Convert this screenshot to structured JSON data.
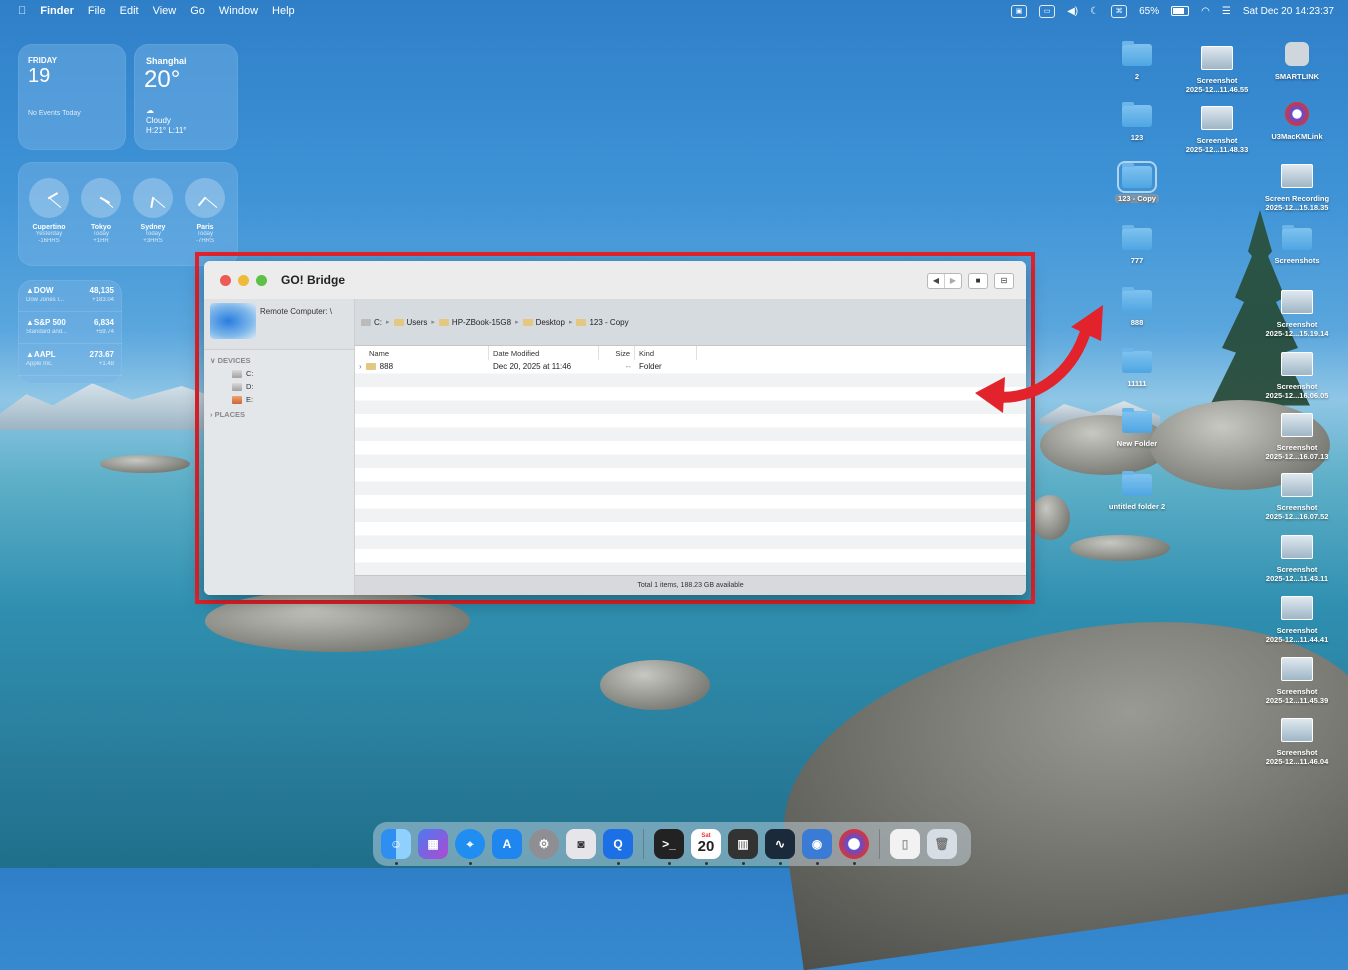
{
  "menubar": {
    "app": "Finder",
    "menus": [
      "File",
      "Edit",
      "View",
      "Go",
      "Window",
      "Help"
    ],
    "battery": "65%",
    "clock": "Sat Dec 20  14:23:37"
  },
  "widgets": {
    "calendar": {
      "day": "FRIDAY",
      "date": "19",
      "events": "No Events Today"
    },
    "weather": {
      "city": "Shanghai",
      "temp": "20°",
      "condition": "Cloudy",
      "range": "H:21° L:11°"
    },
    "clocks": [
      {
        "city": "Cupertino",
        "when": "Yesterday",
        "offset": "-16HRS"
      },
      {
        "city": "Tokyo",
        "when": "Today",
        "offset": "+1HR"
      },
      {
        "city": "Sydney",
        "when": "Today",
        "offset": "+3HRS"
      },
      {
        "city": "Paris",
        "when": "Today",
        "offset": "-7HRS"
      }
    ],
    "stocks": [
      {
        "symbol": "▲DOW",
        "price": "48,135",
        "name": "Dow Jones I...",
        "change": "+183.04"
      },
      {
        "symbol": "▲S&P 500",
        "price": "6,834",
        "name": "Standard and...",
        "change": "+59.74"
      },
      {
        "symbol": "▲AAPL",
        "price": "273.67",
        "name": "Apple Inc.",
        "change": "+1.48"
      }
    ]
  },
  "desktop": {
    "folders": [
      "2",
      "123",
      "123 - Copy",
      "777",
      "888",
      "11111",
      "New Folder",
      "untitled folder 2"
    ],
    "col2": [
      {
        "line1": "Screenshot",
        "line2": "2025-12...11.46.55"
      },
      {
        "line1": "Screenshot",
        "line2": "2025-12...11.48.33"
      }
    ],
    "col3": [
      {
        "line1": "SMARTLINK",
        "line2": ""
      },
      {
        "line1": "U3MacKMLink",
        "line2": ""
      },
      {
        "line1": "Screen Recording",
        "line2": "2025-12...15.18.35"
      },
      {
        "line1": "Screenshots",
        "line2": ""
      },
      {
        "line1": "Screenshot",
        "line2": "2025-12...15.19.14"
      },
      {
        "line1": "Screenshot",
        "line2": "2025-12...16.06.05"
      },
      {
        "line1": "Screenshot",
        "line2": "2025-12...16.07.13"
      },
      {
        "line1": "Screenshot",
        "line2": "2025-12...16.07.52"
      },
      {
        "line1": "Screenshot",
        "line2": "2025-12...11.43.11"
      },
      {
        "line1": "Screenshot",
        "line2": "2025-12...11.44.41"
      },
      {
        "line1": "Screenshot",
        "line2": "2025-12...11.45.39"
      },
      {
        "line1": "Screenshot",
        "line2": "2025-12...11.46.04"
      }
    ]
  },
  "window": {
    "title": "GO! Bridge",
    "remote_label": "Remote Computer: \\",
    "sections": {
      "devices": "DEVICES",
      "places": "PLACES"
    },
    "drives": [
      "C:",
      "D:",
      "E:"
    ],
    "path": [
      "C:",
      "Users",
      "HP-ZBook-15G8",
      "Desktop",
      "123 - Copy"
    ],
    "columns": {
      "name": "Name",
      "modified": "Date Modified",
      "size": "Size",
      "kind": "Kind"
    },
    "rows": [
      {
        "name": "888",
        "modified": "Dec 20, 2025 at 11:46",
        "size": "--",
        "kind": "Folder"
      }
    ],
    "status": "Total 1 items, 188.23 GB available"
  },
  "dock": {
    "calendar_day": "Sat",
    "calendar_date": "20"
  },
  "colors": {
    "highlight": "#e3232b",
    "accent": "#1f7be0"
  }
}
